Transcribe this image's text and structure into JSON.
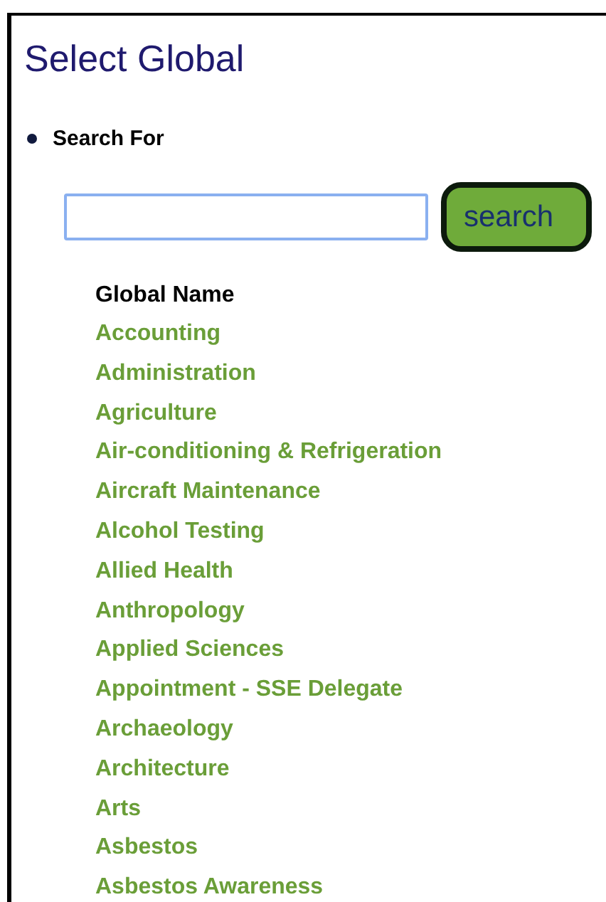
{
  "title": "Select Global",
  "search_label": "Search For",
  "search_button": "search",
  "column_heading": "Global Name",
  "items": [
    "Accounting",
    "Administration",
    "Agriculture",
    "Air-conditioning & Refrigeration",
    "Aircraft Maintenance",
    "Alcohol Testing",
    "Allied Health",
    "Anthropology",
    "Applied Sciences",
    "Appointment - SSE Delegate",
    "Archaeology",
    "Architecture",
    "Arts",
    "Asbestos",
    "Asbestos Awareness"
  ]
}
